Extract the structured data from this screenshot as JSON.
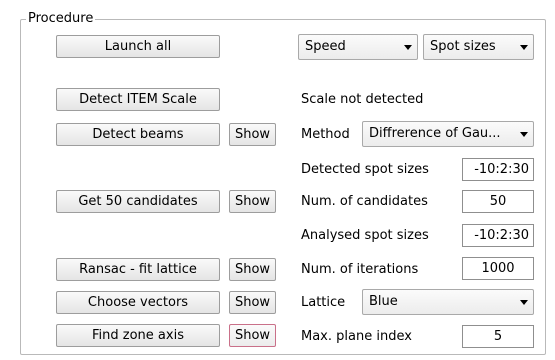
{
  "procedure": {
    "title": "Procedure",
    "launch_all_label": "Launch all",
    "detect_scale_label": "Detect ITEM Scale",
    "scale_status": "Scale not detected",
    "detect_beams_label": "Detect beams",
    "get_candidates_label": "Get 50 candidates",
    "ransac_label": "Ransac - fit lattice",
    "choose_vectors_label": "Choose vectors",
    "find_zone_axis_label": "Find zone axis",
    "show_label": "Show"
  },
  "selectors": {
    "speed": "Speed",
    "spot_sizes": "Spot sizes",
    "method_label": "Method",
    "method_value": "Diffrerence of Gau...",
    "lattice_label": "Lattice",
    "lattice_value": "Blue"
  },
  "params": {
    "detected_spot_sizes_label": "Detected spot sizes",
    "detected_spot_sizes_value": "-10:2:30",
    "num_candidates_label": "Num. of candidates",
    "num_candidates_value": "50",
    "analysed_spot_sizes_label": "Analysed spot sizes",
    "analysed_spot_sizes_value": "-10:2:30",
    "num_iterations_label": "Num. of iterations",
    "num_iterations_value": "1000",
    "max_plane_index_label": "Max. plane index",
    "max_plane_index_value": "5"
  }
}
